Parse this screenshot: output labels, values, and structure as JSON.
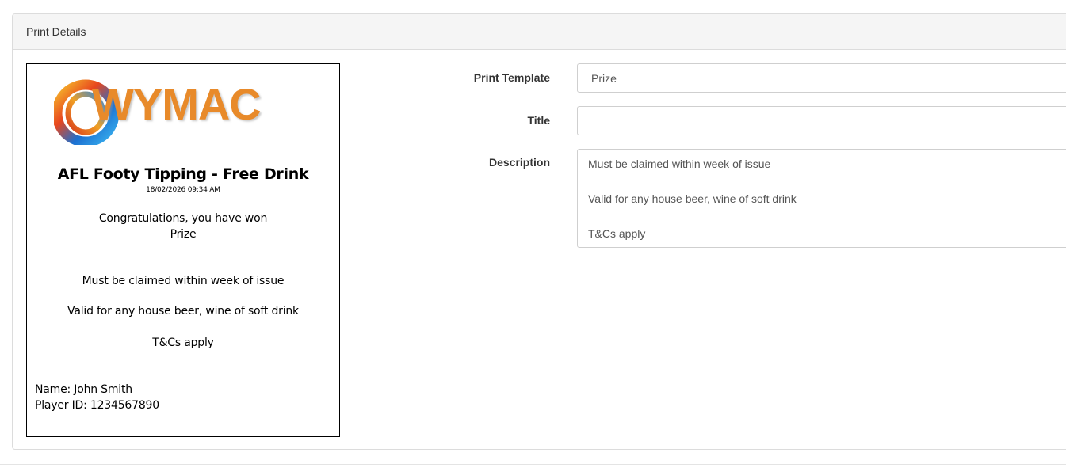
{
  "panel": {
    "title": "Print Details"
  },
  "ticket": {
    "logo_text": "WYMAC",
    "title": "AFL Footy Tipping - Free Drink",
    "datetime": "18/02/2026 09:34 AM",
    "congrats": "Congratulations, you have won",
    "prize": "Prize",
    "description_lines": [
      "Must be claimed within week of issue",
      "Valid for any house beer, wine of soft drink",
      "T&Cs apply"
    ],
    "name_line": "Name: John Smith",
    "player_id_line": "Player ID: 1234567890"
  },
  "form": {
    "print_template": {
      "label": "Print Template",
      "value": "Prize"
    },
    "title": {
      "label": "Title",
      "value": ""
    },
    "description": {
      "label": "Description",
      "lines": [
        "Must be claimed within week of issue",
        "Valid for any house beer, wine of soft drink",
        "T&Cs apply"
      ]
    }
  },
  "colors": {
    "logo_orange": "#e88a2a",
    "panel_header_bg": "#f5f5f5"
  }
}
